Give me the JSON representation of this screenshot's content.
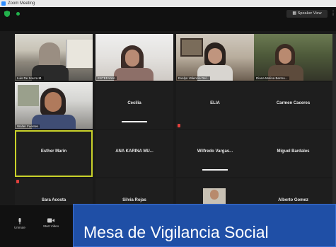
{
  "window": {
    "title": "Zoom Meeting"
  },
  "topbar": {
    "view_label": "Speaker View"
  },
  "tiles": [
    {
      "name": "Luis De Souza M.",
      "type": "video"
    },
    {
      "name": "ESTEFANIA",
      "type": "video"
    },
    {
      "name": "Evelyn Valencia Del...",
      "type": "video"
    },
    {
      "name": "Diana Molina Bermu...",
      "type": "video"
    },
    {
      "name": "Walter Fuentes",
      "type": "video"
    },
    {
      "name": "Cecilia",
      "type": "name"
    },
    {
      "name": "ELIA",
      "type": "name"
    },
    {
      "name": "Carmen Caceres",
      "type": "name"
    },
    {
      "name": "Esther Marin",
      "type": "name"
    },
    {
      "name": "ANA KARINA MU...",
      "type": "name"
    },
    {
      "name": "Wilfredo Vargas...",
      "type": "name"
    },
    {
      "name": "Miguel Bardales",
      "type": "name"
    },
    {
      "name": "Sara Acosta",
      "type": "name"
    },
    {
      "name": "Silvia Rojas",
      "type": "name"
    },
    {
      "name": "",
      "type": "photo"
    },
    {
      "name": "Alberto Gomez",
      "type": "name"
    }
  ],
  "rename_bar": {
    "label": "Esther Marin (Host, me)",
    "more": "..."
  },
  "controls": {
    "mute": "Unmute",
    "video": "Start Video"
  },
  "banner": {
    "text": "Mesa de Vigilancia Social"
  },
  "colors": {
    "accent": "#c9d22a",
    "banner": "#1f4fa6",
    "mic_muted": "#e0403c",
    "security": "#22b24c"
  }
}
